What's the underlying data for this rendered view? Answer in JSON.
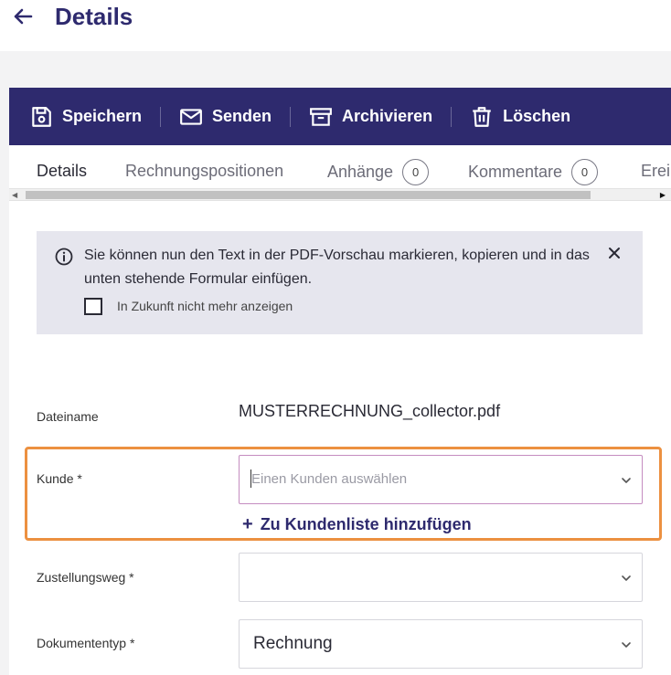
{
  "header": {
    "title": "Details"
  },
  "toolbar": {
    "save_label": "Speichern",
    "send_label": "Senden",
    "archive_label": "Archivieren",
    "delete_label": "Löschen"
  },
  "tabs": [
    {
      "label": "Details",
      "active": true
    },
    {
      "label": "Rechnungspositionen"
    },
    {
      "label": "Anhänge",
      "count": "0"
    },
    {
      "label": "Kommentare",
      "count": "0"
    },
    {
      "label": "Erei"
    }
  ],
  "info": {
    "text": "Sie können nun den Text in der PDF-Vorschau markieren, kopieren und in das unten stehende Formular einfügen.",
    "checkbox_label": "In Zukunft nicht mehr anzeigen"
  },
  "form": {
    "filename_label": "Dateiname",
    "filename_value": "MUSTERRECHNUNG_collector.pdf",
    "customer_label": "Kunde *",
    "customer_placeholder": "Einen Kunden auswählen",
    "add_customer_label": "Zu Kundenliste hinzufügen",
    "delivery_label": "Zustellungsweg *",
    "delivery_value": "",
    "doctype_label": "Dokumententyp *",
    "doctype_value": "Rechnung"
  },
  "colors": {
    "brand": "#2e2a6e",
    "highlight": "#ec9040",
    "info_bg": "#e6e6ee"
  }
}
